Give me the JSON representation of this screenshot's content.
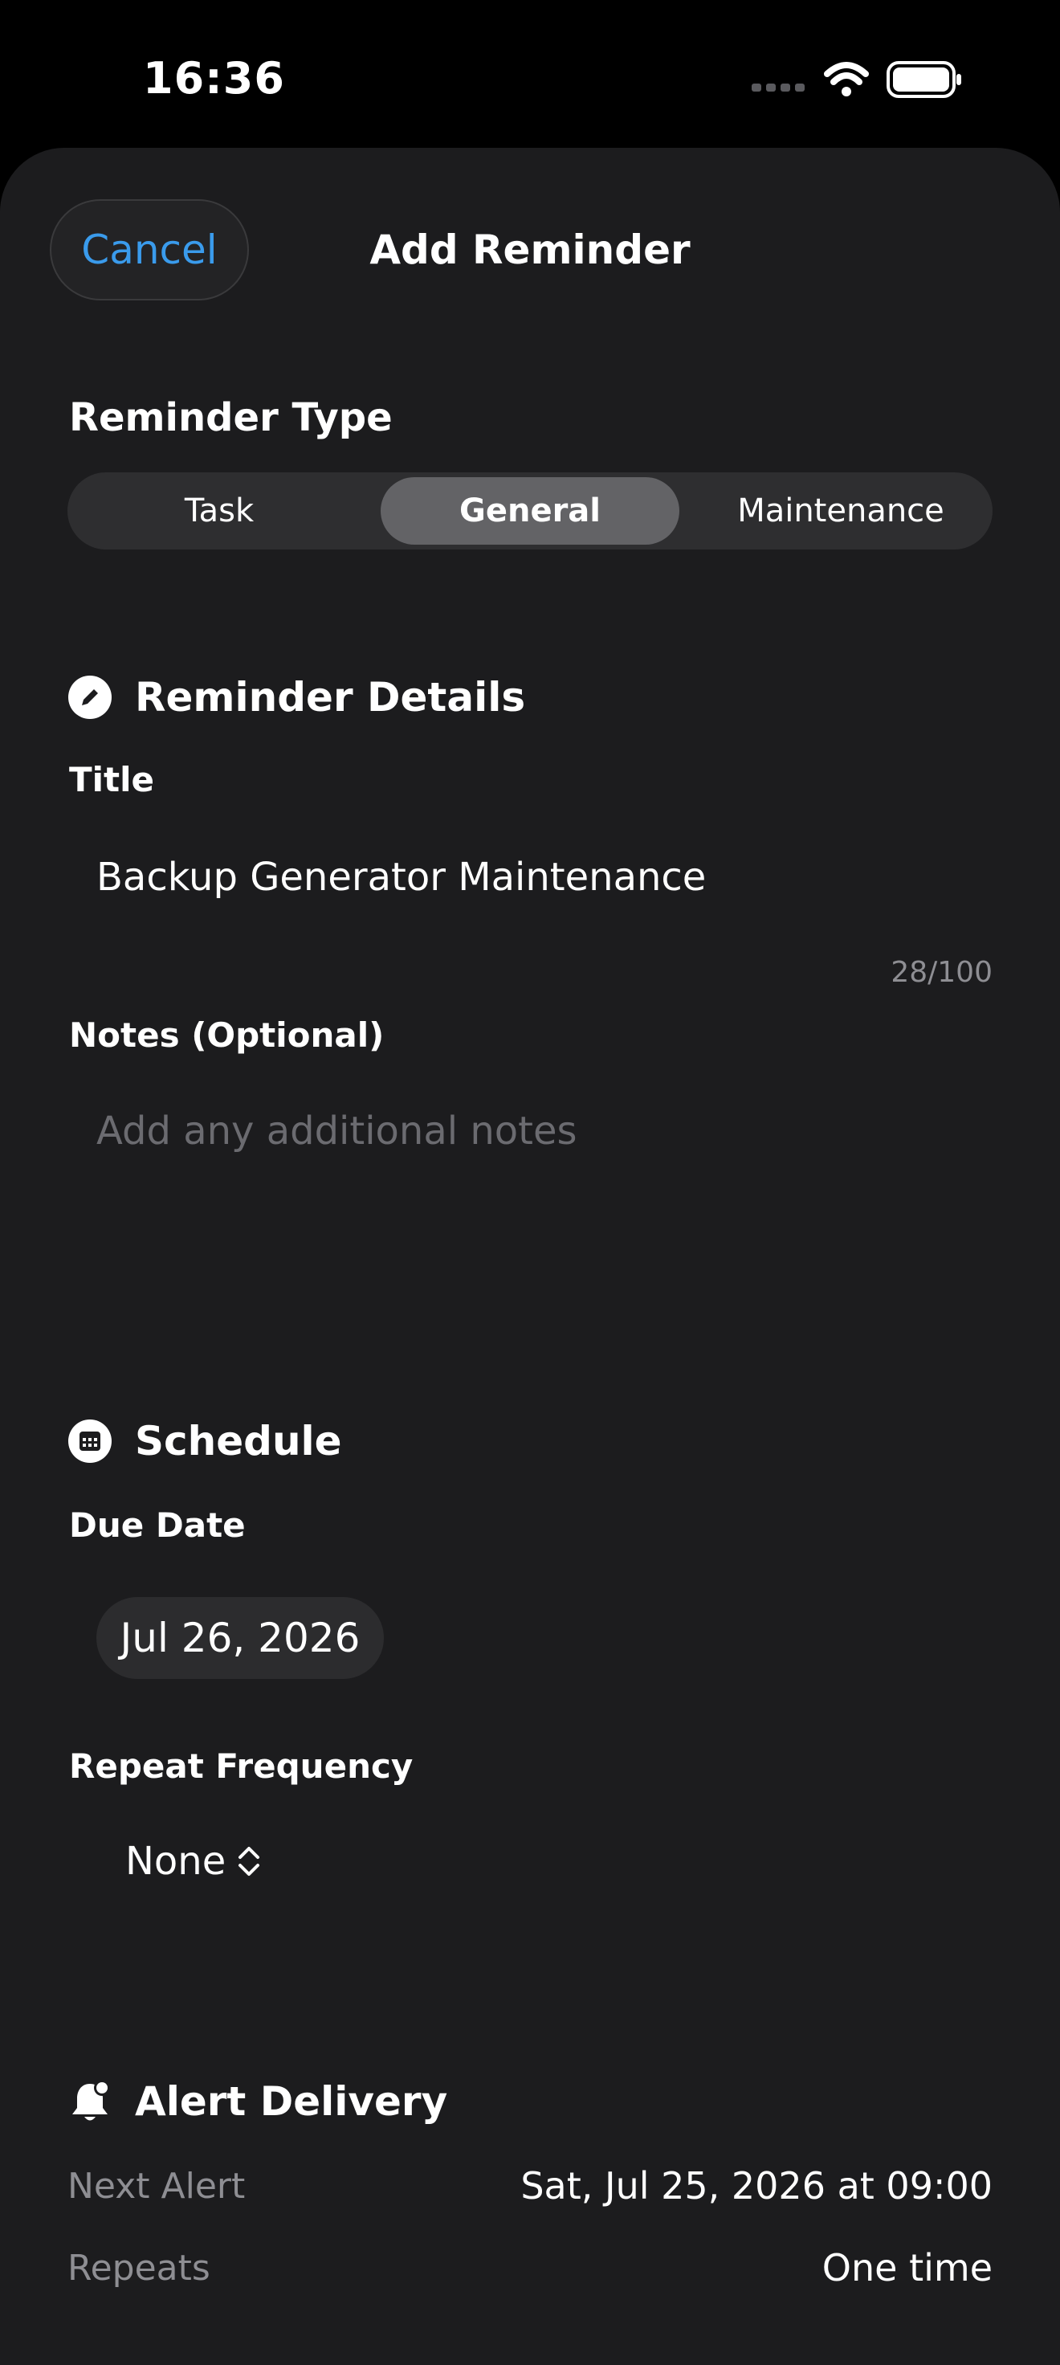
{
  "status_bar": {
    "time": "16:36"
  },
  "header": {
    "cancel_label": "Cancel",
    "title": "Add Reminder"
  },
  "reminder_type": {
    "label": "Reminder Type",
    "options": [
      "Task",
      "General",
      "Maintenance"
    ],
    "selected": "General"
  },
  "details": {
    "section_title": "Reminder Details",
    "section_icon": "pencil-circle-icon",
    "title_label": "Title",
    "title_value": "Backup Generator Maintenance",
    "title_counter": "28/100",
    "notes_label": "Notes (Optional)",
    "notes_placeholder": "Add any additional notes"
  },
  "schedule": {
    "section_title": "Schedule",
    "section_icon": "calendar-circle-icon",
    "due_date_label": "Due Date",
    "due_date_value": "Jul 26, 2026",
    "repeat_label": "Repeat Frequency",
    "repeat_value": "None"
  },
  "alert_delivery": {
    "section_title": "Alert Delivery",
    "section_icon": "bell-badge-icon",
    "next_alert_label": "Next Alert",
    "next_alert_value": "Sat, Jul 25, 2026 at 09:00",
    "repeats_label": "Repeats",
    "repeats_value": "One time"
  },
  "colors": {
    "background": "#1c1c1e",
    "accent": "#3a9bec",
    "segment_active": "#636366"
  }
}
